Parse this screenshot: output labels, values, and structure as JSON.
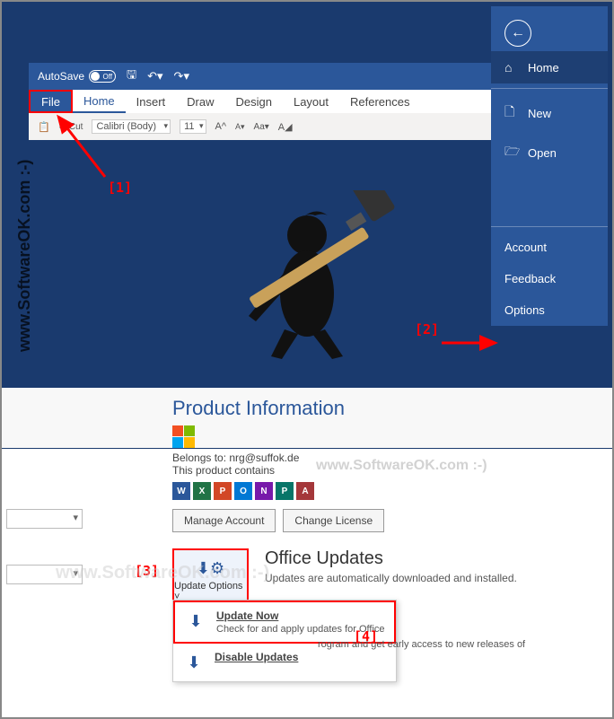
{
  "titlebar": {
    "autosave_label": "AutoSave",
    "autosave_state": "Off"
  },
  "ribbon": {
    "tabs": [
      "File",
      "Home",
      "Insert",
      "Draw",
      "Design",
      "Layout",
      "References"
    ],
    "cut_label": "Cut",
    "font_name": "Calibri (Body)",
    "font_size": "11"
  },
  "backstage": {
    "items": [
      {
        "icon": "⌂",
        "label": "Home"
      },
      {
        "icon": "🗋",
        "label": "New"
      },
      {
        "icon": "🗁",
        "label": "Open"
      }
    ],
    "bottom": [
      "Account",
      "Feedback",
      "Options"
    ]
  },
  "product": {
    "heading": "Product Information",
    "belongs": "Belongs to: nrg@suffok.de",
    "contains": "This product contains",
    "apps": [
      {
        "letter": "W",
        "color": "#2b579a"
      },
      {
        "letter": "X",
        "color": "#217346"
      },
      {
        "letter": "P",
        "color": "#d24726"
      },
      {
        "letter": "O",
        "color": "#0078d4"
      },
      {
        "letter": "N",
        "color": "#7719aa"
      },
      {
        "letter": "P",
        "color": "#077568"
      },
      {
        "letter": "A",
        "color": "#a4373a"
      }
    ],
    "manage_btn": "Manage Account",
    "license_btn": "Change License"
  },
  "updates": {
    "btn_label": "Update Options",
    "heading": "Office Updates",
    "sub": "Updates are automatically downloaded and installed.",
    "menu": [
      {
        "title": "Update Now",
        "desc": "Check for and apply updates for Office"
      },
      {
        "title": "Disable Updates",
        "desc": ""
      }
    ],
    "extra": "rogram and get early access to new releases of"
  },
  "annotations": {
    "n1": "[1]",
    "n2": "[2]",
    "n3": "[3]",
    "n4": "[4]"
  },
  "watermarks": {
    "side": "www.SoftwareOK.com :-)",
    "mid": "www.SoftwareOK.com :-)"
  }
}
